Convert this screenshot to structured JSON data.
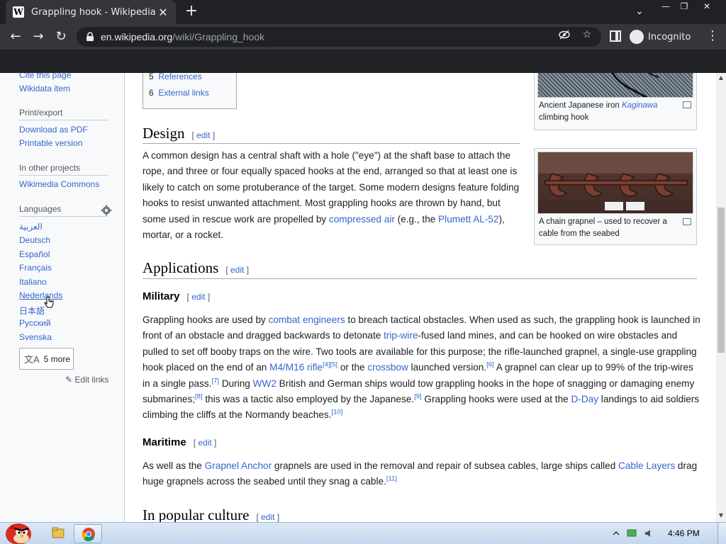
{
  "browser": {
    "tab_title": "Grappling hook - Wikipedia",
    "tab_favicon": "W",
    "url_domain": "en.wikipedia.org",
    "url_path": "/wiki/Grappling_hook",
    "profile_label": "Incognito"
  },
  "sidebar": {
    "cite": "Cite this page",
    "wikidata": "Wikidata item",
    "print_head": "Print/export",
    "download_pdf": "Download as PDF",
    "printable": "Printable version",
    "other_head": "In other projects",
    "commons": "Wikimedia Commons",
    "lang_head": "Languages",
    "languages": [
      "العربية",
      "Deutsch",
      "Español",
      "Français",
      "Italiano",
      "Nederlands",
      "日本語",
      "Русский",
      "Svenska"
    ],
    "more_label": "5 more",
    "edit_links": "Edit links"
  },
  "toc": {
    "items": [
      {
        "num": "5",
        "label": "References"
      },
      {
        "num": "6",
        "label": "External links"
      }
    ]
  },
  "article": {
    "edit_label": "edit",
    "design_heading": "Design",
    "design_p": {
      "t1": "A common design has a central shaft with a hole (\"eye\") at the shaft base to attach the rope, and three or four equally spaced hooks at the end, arranged so that at least one is likely to catch on some protuberance of the target. Some modern designs feature folding hooks to resist unwanted attachment. Most grappling hooks are thrown by hand, but some used in rescue work are propelled by ",
      "l1": "compressed air",
      "t2": " (e.g., the ",
      "l2": "Plumett AL-52",
      "t3": "), mortar, or a rocket."
    },
    "applications_heading": "Applications",
    "military_heading": "Military",
    "military_p": {
      "t1": "Grappling hooks are used by ",
      "l1": "combat engineers",
      "t2": " to breach tactical obstacles. When used as such, the grappling hook is launched in front of an obstacle and dragged backwards to detonate ",
      "l2": "trip-wire",
      "t3": "-fused land mines, and can be hooked on wire obstacles and pulled to set off booby traps on the wire. Two tools are available for this purpose; the rifle-launched grapnel, a single-use grappling hook placed on the end of an ",
      "l3": "M4/M16 rifle",
      "s1": "[4][5]",
      "t4": " or the ",
      "l4": "crossbow",
      "t5": " launched version.",
      "s2": "[6]",
      "t6": " A grapnel can clear up to 99% of the trip-wires in a single pass.",
      "s3": "[7]",
      "t7": " During ",
      "l5": "WW2",
      "t8": " British and German ships would tow grappling hooks in the hope of snagging or damaging enemy submarines;",
      "s4": "[8]",
      "t9": " this was a tactic also employed by the Japanese.",
      "s5": "[9]",
      "t10": " Grappling hooks were used at the ",
      "l6": "D-Day",
      "t11": " landings to aid soldiers climbing the cliffs at the Normandy beaches.",
      "s6": "[10]"
    },
    "maritime_heading": "Maritime",
    "maritime_p": {
      "t1": "As well as the ",
      "l1": "Grapnel Anchor",
      "t2": " grapnels are used in the removal and repair of subsea cables, large ships called ",
      "l2": "Cable Layers",
      "t3": " drag huge grapnels across the seabed until they snag a cable.",
      "s1": "[11]"
    },
    "popular_heading": "In popular culture"
  },
  "figures": {
    "fig1_cap_pre": "Ancient Japanese iron ",
    "fig1_cap_link": "Kaginawa",
    "fig1_cap_post": "climbing hook",
    "fig2_cap": "A chain grapnel – used to recover a cable from the seabed"
  },
  "taskbar": {
    "time": "4:46 PM"
  }
}
